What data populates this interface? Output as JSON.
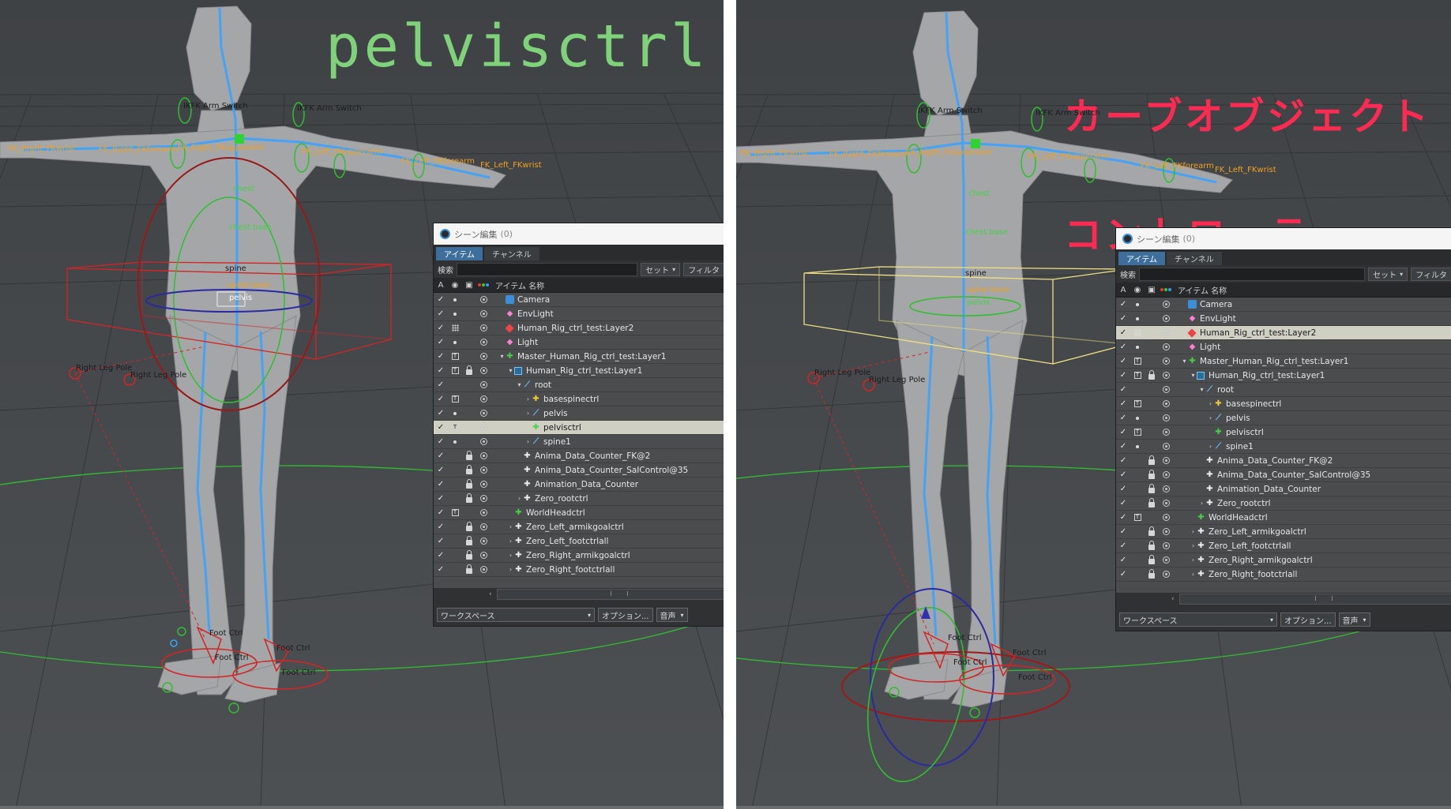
{
  "left_view": {
    "title": "pelvisctrl",
    "labels": {
      "ikfk_switch_1": "IKFK Arm Switch",
      "ikfk_switch_2": "IKFK Arm Switch",
      "right_fkwrist": "FK_Right_FKwrist",
      "right_fkforearm": "FK_Right_FKforearm",
      "right_fkupperarm": "FK_Right_FKupperarm",
      "left_fkupperarm": "FK_Left_FKupperarm",
      "left_fkforearm": "FK_Left_FKforearm",
      "left_fkwrist": "FK_Left_FKwrist",
      "chest": "chest",
      "chest_base": "chest base",
      "spine": "spine",
      "spine_base": "spine base",
      "pelvis": "pelvis",
      "right_leg_pole_1": "Right Leg Pole",
      "right_leg_pole_2": "Right Leg Pole",
      "foot_ctrl_1": "Foot Ctrl",
      "foot_ctrl_2": "Foot Ctrl",
      "foot_ctrl_3": "Foot Ctrl",
      "foot_ctrl_4": "Foot Ctrl"
    }
  },
  "right_view": {
    "title_line1": "カーブオブジェクト",
    "title_line2": "コントローラー",
    "labels": {
      "ikfk_switch_1": "IKFK Arm Switch",
      "ikfk_switch_2": "IKFK Arm Switch",
      "right_fkwrist": "FK_Right_FKwrist",
      "right_fkforearm": "FK_Right_FKforearm",
      "right_fkupperarm": "FK_Right_FKupperarm",
      "left_fkupperarm": "FK_Left_FKupperarm",
      "left_fkforearm": "FK_Left_FKforearm",
      "left_fkwrist": "FK_Left_FKwrist",
      "chest": "chest",
      "chest_base": "chest base",
      "spine": "spine",
      "spine_base": "spine base",
      "pelvis": "pelvis",
      "right_leg_pole_1": "Right Leg Pole",
      "right_leg_pole_2": "Right Leg Pole",
      "foot_ctrl_1": "Foot Ctrl",
      "foot_ctrl_2": "Foot Ctrl",
      "foot_ctrl_3": "Foot Ctrl",
      "foot_ctrl_4": "Foot Ctrl"
    }
  },
  "scene_editor": {
    "title": "シーン編集",
    "count": "(0)",
    "tabs": [
      "アイテム",
      "チャンネル"
    ],
    "search_label": "検索",
    "set_button": "セット",
    "filter_button": "フィルタ",
    "header_a": "A",
    "header_name": "アイテム 名称",
    "workspace": "ワークスペース",
    "options": "オプション...",
    "audio": "音声",
    "colors": {
      "accent": "#3e6e9c",
      "selected_row": "#cfcfc4",
      "row_bg": "#4a4c4e"
    }
  },
  "items": [
    {
      "name": "Camera",
      "indent": 0,
      "icon": "camera-icon",
      "arrow": "",
      "vis": "dot",
      "lock": false
    },
    {
      "name": "EnvLight",
      "indent": 0,
      "icon": "light-icon",
      "arrow": "",
      "vis": "dot",
      "lock": false
    },
    {
      "name": "Human_Rig_ctrl_test:Layer2",
      "indent": 0,
      "icon": "mesh-icon",
      "arrow": "",
      "vis": "grid",
      "lock": false
    },
    {
      "name": "Light",
      "indent": 0,
      "icon": "light-icon",
      "arrow": "",
      "vis": "dot",
      "lock": false
    },
    {
      "name": "Master_Human_Rig_ctrl_test:Layer1",
      "indent": 0,
      "icon": "locator-green-icon",
      "arrow": "▾",
      "vis": "toggle",
      "lock": false
    },
    {
      "name": "Human_Rig_ctrl_test:Layer1",
      "indent": 1,
      "icon": "mesh-cube-icon",
      "arrow": "▾",
      "vis": "toggle",
      "lock": true
    },
    {
      "name": "root",
      "indent": 2,
      "icon": "bone-icon",
      "arrow": "▾",
      "vis": "",
      "lock": false
    },
    {
      "name": "basespinectrl",
      "indent": 3,
      "icon": "locator-yellow-icon",
      "arrow": "›",
      "vis": "toggle",
      "lock": false
    },
    {
      "name": "pelvis",
      "indent": 3,
      "icon": "bone-icon",
      "arrow": "›",
      "vis": "dot",
      "lock": false
    },
    {
      "name": "pelvisctrl",
      "indent": 3,
      "icon": "locator-green-icon",
      "arrow": "",
      "vis": "toggle",
      "lock": false
    },
    {
      "name": "spine1",
      "indent": 3,
      "icon": "bone-icon",
      "arrow": "›",
      "vis": "dot",
      "lock": false
    },
    {
      "name": "Anima_Data_Counter_FK@2",
      "indent": 2,
      "icon": "locator-white-icon",
      "arrow": "",
      "vis": "",
      "lock": true
    },
    {
      "name": "Anima_Data_Counter_SaIControl@35",
      "indent": 2,
      "icon": "locator-white-icon",
      "arrow": "",
      "vis": "",
      "lock": true
    },
    {
      "name": "Animation_Data_Counter",
      "indent": 2,
      "icon": "locator-white-icon",
      "arrow": "",
      "vis": "",
      "lock": true
    },
    {
      "name": "Zero_rootctrl",
      "indent": 2,
      "icon": "locator-white-icon",
      "arrow": "›",
      "vis": "",
      "lock": true
    },
    {
      "name": "WorldHeadctrl",
      "indent": 1,
      "icon": "locator-green-icon",
      "arrow": "",
      "vis": "toggle",
      "lock": false
    },
    {
      "name": "Zero_Left_armikgoalctrl",
      "indent": 1,
      "icon": "locator-white-icon",
      "arrow": "›",
      "vis": "",
      "lock": true
    },
    {
      "name": "Zero_Left_footctrlall",
      "indent": 1,
      "icon": "locator-white-icon",
      "arrow": "›",
      "vis": "",
      "lock": true
    },
    {
      "name": "Zero_Right_armikgoalctrl",
      "indent": 1,
      "icon": "locator-white-icon",
      "arrow": "›",
      "vis": "",
      "lock": true
    },
    {
      "name": "Zero_Right_footctrlall",
      "indent": 1,
      "icon": "locator-white-icon",
      "arrow": "›",
      "vis": "",
      "lock": true
    }
  ],
  "left_selected": "pelvisctrl",
  "right_selected": "Human_Rig_ctrl_test:Layer2"
}
